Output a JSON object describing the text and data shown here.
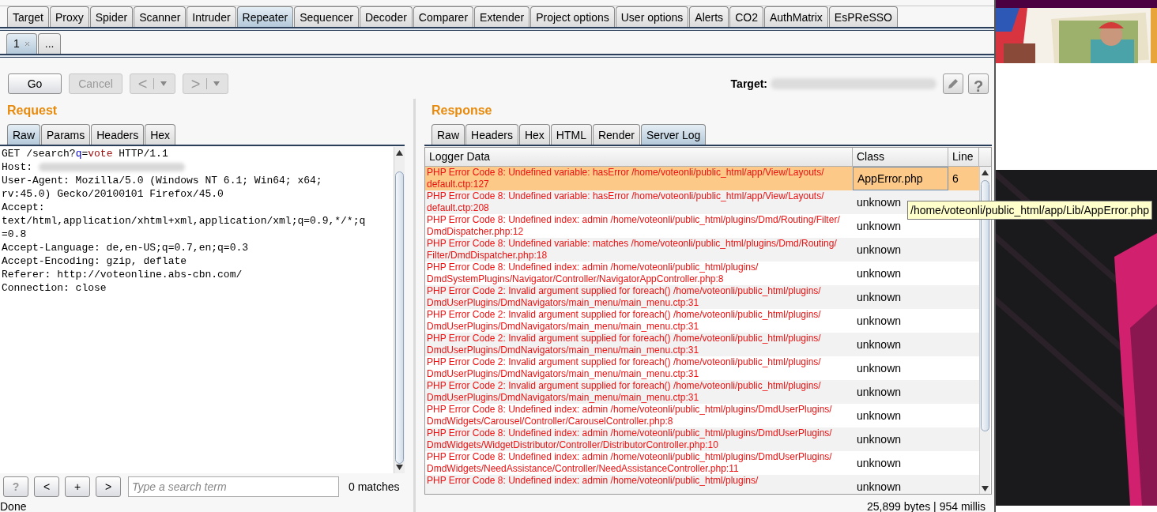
{
  "main_tabs": [
    {
      "label": "Target",
      "selected": false
    },
    {
      "label": "Proxy",
      "selected": false
    },
    {
      "label": "Spider",
      "selected": false
    },
    {
      "label": "Scanner",
      "selected": false
    },
    {
      "label": "Intruder",
      "selected": false
    },
    {
      "label": "Repeater",
      "selected": true
    },
    {
      "label": "Sequencer",
      "selected": false
    },
    {
      "label": "Decoder",
      "selected": false
    },
    {
      "label": "Comparer",
      "selected": false
    },
    {
      "label": "Extender",
      "selected": false
    },
    {
      "label": "Project options",
      "selected": false
    },
    {
      "label": "User options",
      "selected": false
    },
    {
      "label": "Alerts",
      "selected": false
    },
    {
      "label": "CO2",
      "selected": false
    },
    {
      "label": "AuthMatrix",
      "selected": false
    },
    {
      "label": "EsPReSSO",
      "selected": false
    }
  ],
  "repeater_tabs": [
    {
      "label": "1",
      "closable": true,
      "selected": true
    },
    {
      "label": "...",
      "closable": false,
      "selected": false
    }
  ],
  "toolbar": {
    "go": {
      "label": "Go",
      "disabled": false
    },
    "cancel": {
      "label": "Cancel",
      "disabled": true
    },
    "back": {
      "label": "<",
      "disabled": true
    },
    "forward": {
      "label": ">",
      "disabled": true
    },
    "target_label": "Target:",
    "help": "?"
  },
  "request": {
    "title": "Request",
    "tabs": [
      {
        "label": "Raw",
        "selected": true
      },
      {
        "label": "Params",
        "selected": false
      },
      {
        "label": "Headers",
        "selected": false
      },
      {
        "label": "Hex",
        "selected": false
      }
    ],
    "lines": [
      [
        {
          "kind": "plain",
          "text": "GET /search?"
        },
        {
          "kind": "param-name",
          "text": "q"
        },
        {
          "kind": "plain",
          "text": "="
        },
        {
          "kind": "param-value",
          "text": "vote"
        },
        {
          "kind": "plain",
          "text": " HTTP/1.1"
        }
      ],
      [
        {
          "kind": "plain",
          "text": "Host: "
        },
        {
          "kind": "redacted"
        }
      ],
      [
        {
          "kind": "plain",
          "text": "User-Agent: Mozilla/5.0 (Windows NT 6.1; Win64; x64;"
        }
      ],
      [
        {
          "kind": "plain",
          "text": "rv:45.0) Gecko/20100101 Firefox/45.0"
        }
      ],
      [
        {
          "kind": "plain",
          "text": "Accept:"
        }
      ],
      [
        {
          "kind": "plain",
          "text": "text/html,application/xhtml+xml,application/xml;q=0.9,*/*;q"
        }
      ],
      [
        {
          "kind": "plain",
          "text": "=0.8"
        }
      ],
      [
        {
          "kind": "plain",
          "text": "Accept-Language: de,en-US;q=0.7,en;q=0.3"
        }
      ],
      [
        {
          "kind": "plain",
          "text": "Accept-Encoding: gzip, deflate"
        }
      ],
      [
        {
          "kind": "plain",
          "text": "Referer: http://voteonline.abs-cbn.com/"
        }
      ],
      [
        {
          "kind": "plain",
          "text": "Connection: close"
        }
      ]
    ],
    "search": {
      "buttons": [
        {
          "label": "?",
          "kind": "help"
        },
        {
          "label": "<",
          "kind": "nav"
        },
        {
          "label": "+",
          "kind": "nav"
        },
        {
          "label": ">",
          "kind": "nav"
        }
      ],
      "placeholder": "Type a search term",
      "matches": "0 matches"
    }
  },
  "response": {
    "title": "Response",
    "tabs": [
      {
        "label": "Raw",
        "selected": false
      },
      {
        "label": "Headers",
        "selected": false
      },
      {
        "label": "Hex",
        "selected": false
      },
      {
        "label": "HTML",
        "selected": false
      },
      {
        "label": "Render",
        "selected": false
      },
      {
        "label": "Server Log",
        "selected": true
      }
    ],
    "table": {
      "columns": [
        "Logger Data",
        "Class",
        "Line"
      ],
      "rows": [
        {
          "data": [
            "PHP Error Code 8: Undefined variable: hasError /home/voteonli/public_html/app/View/Layouts/",
            "default.ctp:127"
          ],
          "class": "AppError.php",
          "line": "6",
          "selected": true
        },
        {
          "data": [
            "PHP Error Code 8: Undefined variable: hasError /home/voteonli/public_html/app/View/Layouts/",
            "default.ctp:208"
          ],
          "class": "unknown",
          "selected": false
        },
        {
          "data": [
            "PHP Error Code 8: Undefined index: admin /home/voteonli/public_html/plugins/Dmd/Routing/Filter/",
            "DmdDispatcher.php:12"
          ],
          "class": "unknown",
          "selected": false
        },
        {
          "data": [
            "PHP Error Code 8: Undefined variable: matches /home/voteonli/public_html/plugins/Dmd/Routing/",
            "Filter/DmdDispatcher.php:18"
          ],
          "class": "unknown",
          "selected": false
        },
        {
          "data": [
            "PHP Error Code 8: Undefined index: admin /home/voteonli/public_html/plugins/",
            "DmdSystemPlugins/Navigator/Controller/NavigatorAppController.php:8"
          ],
          "class": "unknown",
          "selected": false
        },
        {
          "data": [
            "PHP Error Code 2: Invalid argument supplied for foreach() /home/voteonli/public_html/plugins/",
            "DmdUserPlugins/DmdNavigators/main_menu/main_menu.ctp:31"
          ],
          "class": "unknown",
          "selected": false
        },
        {
          "data": [
            "PHP Error Code 2: Invalid argument supplied for foreach() /home/voteonli/public_html/plugins/",
            "DmdUserPlugins/DmdNavigators/main_menu/main_menu.ctp:31"
          ],
          "class": "unknown",
          "selected": false
        },
        {
          "data": [
            "PHP Error Code 2: Invalid argument supplied for foreach() /home/voteonli/public_html/plugins/",
            "DmdUserPlugins/DmdNavigators/main_menu/main_menu.ctp:31"
          ],
          "class": "unknown",
          "selected": false
        },
        {
          "data": [
            "PHP Error Code 2: Invalid argument supplied for foreach() /home/voteonli/public_html/plugins/",
            "DmdUserPlugins/DmdNavigators/main_menu/main_menu.ctp:31"
          ],
          "class": "unknown",
          "selected": false
        },
        {
          "data": [
            "PHP Error Code 2: Invalid argument supplied for foreach() /home/voteonli/public_html/plugins/",
            "DmdUserPlugins/DmdNavigators/main_menu/main_menu.ctp:31"
          ],
          "class": "unknown",
          "selected": false
        },
        {
          "data": [
            "PHP Error Code 8: Undefined index: admin /home/voteonli/public_html/plugins/DmdUserPlugins/",
            "DmdWidgets/Carousel/Controller/CarouselController.php:8"
          ],
          "class": "unknown",
          "selected": false
        },
        {
          "data": [
            "PHP Error Code 8: Undefined index: admin /home/voteonli/public_html/plugins/DmdUserPlugins/",
            "DmdWidgets/WidgetDistributor/Controller/DistributorController.php:10"
          ],
          "class": "unknown",
          "selected": false
        },
        {
          "data": [
            "PHP Error Code 8: Undefined index: admin /home/voteonli/public_html/plugins/DmdUserPlugins/",
            "DmdWidgets/NeedAssistance/Controller/NeedAssistanceController.php:11"
          ],
          "class": "unknown",
          "selected": false
        },
        {
          "data": [
            "PHP Error Code 8: Undefined index: admin /home/voteonli/public_html/plugins/"
          ],
          "class": "unknown",
          "selected": false
        }
      ]
    },
    "tooltip": "/home/voteonli/public_html/app/Lib/AppError.php"
  },
  "status_bar": {
    "left": "Done",
    "right": "25,899 bytes | 954 millis"
  }
}
